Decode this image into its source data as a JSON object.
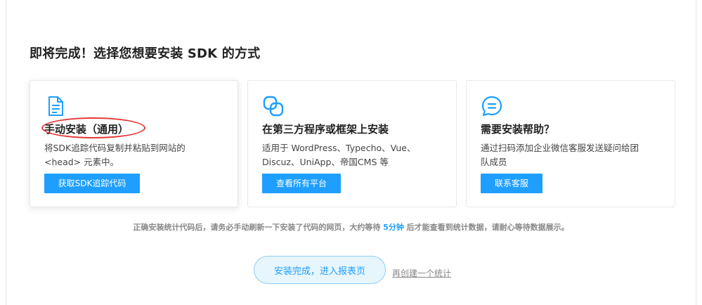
{
  "page": {
    "title": "即将完成！选择您想要安装 SDK 的方式"
  },
  "cards": [
    {
      "icon": "document-icon",
      "title": "手动安装（通用）",
      "desc_line1": "将SDK追踪代码复制并粘贴到网站的",
      "desc_line2": "<head> 元素中。",
      "button": "获取SDK追踪代码"
    },
    {
      "icon": "link-icon",
      "title": "在第三方程序或框架上安装",
      "desc_line1": "适用于 WordPress、Typecho、Vue、",
      "desc_line2": "Discuz、UniApp、帝国CMS 等",
      "button": "查看所有平台"
    },
    {
      "icon": "chat-icon",
      "title": "需要安装帮助？",
      "desc_line1": "通过扫码添加企业微信客服发送疑问给团",
      "desc_line2": "队成员",
      "button": "联系客服"
    }
  ],
  "notice": {
    "before": "正确安装统计代码后，请务必手动刷新一下安装了代码的网页，大约等待 ",
    "highlight": "5分钟",
    "after": " 后才能查看到统计数据，请耐心等待数据展示。"
  },
  "footer": {
    "finish_button": "安装完成，进入报表页",
    "recreate_link": "再创建一个统计"
  },
  "colors": {
    "accent": "#1e9fff",
    "annotation": "#e33a3a"
  }
}
